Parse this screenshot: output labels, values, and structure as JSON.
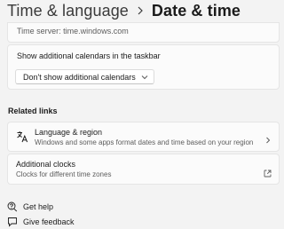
{
  "header": {
    "parent": "Time & language",
    "current": "Date & time"
  },
  "time_server": {
    "text": "Time server: time.windows.com"
  },
  "calendars": {
    "title": "Show additional calendars in the taskbar",
    "selected": "Don't show additional calendars"
  },
  "related_links": {
    "title": "Related links",
    "items": [
      {
        "title": "Language & region",
        "subtitle": "Windows and some apps format dates and time based on your region",
        "icon": "language-region-icon",
        "action_icon": "chevron-right-icon"
      },
      {
        "title": "Additional clocks",
        "subtitle": "Clocks for different time zones",
        "action_icon": "open-external-icon"
      }
    ]
  },
  "bottom_links": {
    "help": {
      "label": "Get help",
      "icon": "help-icon"
    },
    "feedback": {
      "label": "Give feedback",
      "icon": "feedback-icon"
    }
  }
}
